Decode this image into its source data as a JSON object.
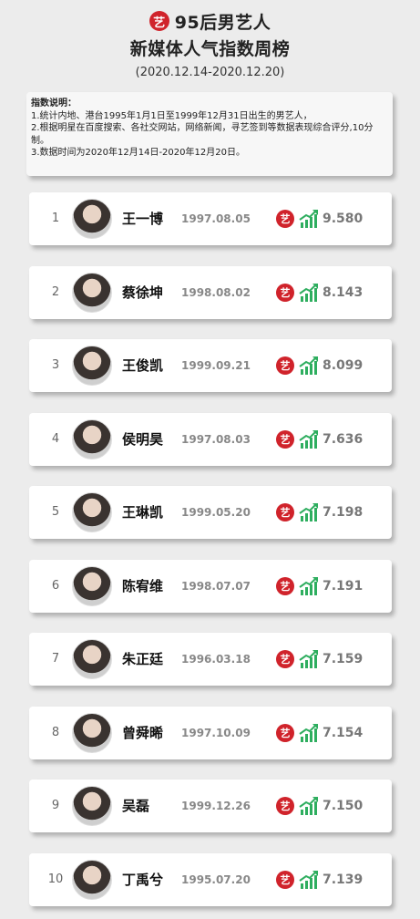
{
  "header": {
    "logo_char": "艺",
    "title_line1": "95后男艺人",
    "title_line2": "新媒体人气指数周榜",
    "date_range": "(2020.12.14-2020.12.20)"
  },
  "description": {
    "title": "指数说明：",
    "lines": [
      "1.统计内地、港台1995年1月1日至1999年12月31日出生的男艺人，",
      "2.根据明星在百度搜索、各社交网站，网络新闻，寻艺签到等数据表现综合评分,10分制。",
      "3.数据时间为2020年12月14日-2020年12月20日。"
    ]
  },
  "badge_char": "艺",
  "colors": {
    "accent_red": "#d0232b",
    "trend_green": "#2eae5f"
  },
  "icons": {
    "trend": "trend-up-icon",
    "avatar": "avatar"
  },
  "rankings": [
    {
      "rank": "1",
      "name": "王一博",
      "birth": "1997.08.05",
      "score": "9.580"
    },
    {
      "rank": "2",
      "name": "蔡徐坤",
      "birth": "1998.08.02",
      "score": "8.143"
    },
    {
      "rank": "3",
      "name": "王俊凯",
      "birth": "1999.09.21",
      "score": "8.099"
    },
    {
      "rank": "4",
      "name": "侯明昊",
      "birth": "1997.08.03",
      "score": "7.636"
    },
    {
      "rank": "5",
      "name": "王琳凯",
      "birth": "1999.05.20",
      "score": "7.198"
    },
    {
      "rank": "6",
      "name": "陈宥维",
      "birth": "1998.07.07",
      "score": "7.191"
    },
    {
      "rank": "7",
      "name": "朱正廷",
      "birth": "1996.03.18",
      "score": "7.159"
    },
    {
      "rank": "8",
      "name": "曾舜晞",
      "birth": "1997.10.09",
      "score": "7.154"
    },
    {
      "rank": "9",
      "name": "吴磊",
      "birth": "1999.12.26",
      "score": "7.150"
    },
    {
      "rank": "10",
      "name": "丁禹兮",
      "birth": "1995.07.20",
      "score": "7.139"
    }
  ]
}
